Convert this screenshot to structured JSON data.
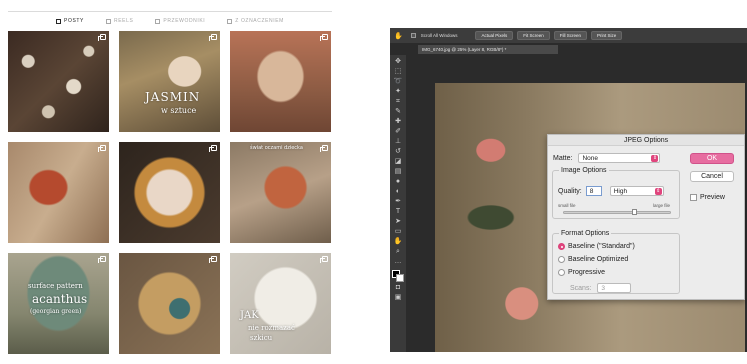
{
  "instagram": {
    "tabs": [
      {
        "label": "POSTY",
        "active": true
      },
      {
        "label": "REELS",
        "active": false
      },
      {
        "label": "PRZEWODNIKI",
        "active": false
      },
      {
        "label": "Z OZNACZENIEM",
        "active": false
      }
    ],
    "captions": {
      "tile2_line1": "JASMIN",
      "tile2_line2": "w sztuce",
      "tile6": "świat oczami dziecka",
      "tile7_line1": "surface pattern",
      "tile7_line2": "acanthus",
      "tile7_line3": "(georgian green)",
      "tile9_line1": "JAK",
      "tile9_line2": "nie rozmazać",
      "tile9_line3": "szkicu"
    }
  },
  "photoshop": {
    "options_bar": {
      "scroll_all": "Scroll All Windows",
      "actual_pixels": "Actual Pixels",
      "fit_screen": "Fit Screen",
      "fill_screen": "Fill Screen",
      "print_size": "Print Size"
    },
    "doc_tab": "IMG_6740.jpg @ 25% (Layer 8, RGB/8*) *",
    "dialog": {
      "title": "JPEG Options",
      "matte_label": "Matte:",
      "matte_value": "None",
      "image_options": "Image Options",
      "quality_label": "Quality:",
      "quality_value": "8",
      "quality_preset": "High",
      "small_file": "small file",
      "large_file": "large file",
      "quality_fraction": 0.67,
      "format_options": "Format Options",
      "formats": [
        {
          "label": "Baseline (\"Standard\")",
          "selected": true
        },
        {
          "label": "Baseline Optimized",
          "selected": false
        },
        {
          "label": "Progressive",
          "selected": false
        }
      ],
      "scans_label": "Scans:",
      "scans_value": "3",
      "ok": "OK",
      "cancel": "Cancel",
      "preview": "Preview"
    }
  },
  "colors": {
    "accent": "#e0457d",
    "ok_button": "#e76da0"
  }
}
